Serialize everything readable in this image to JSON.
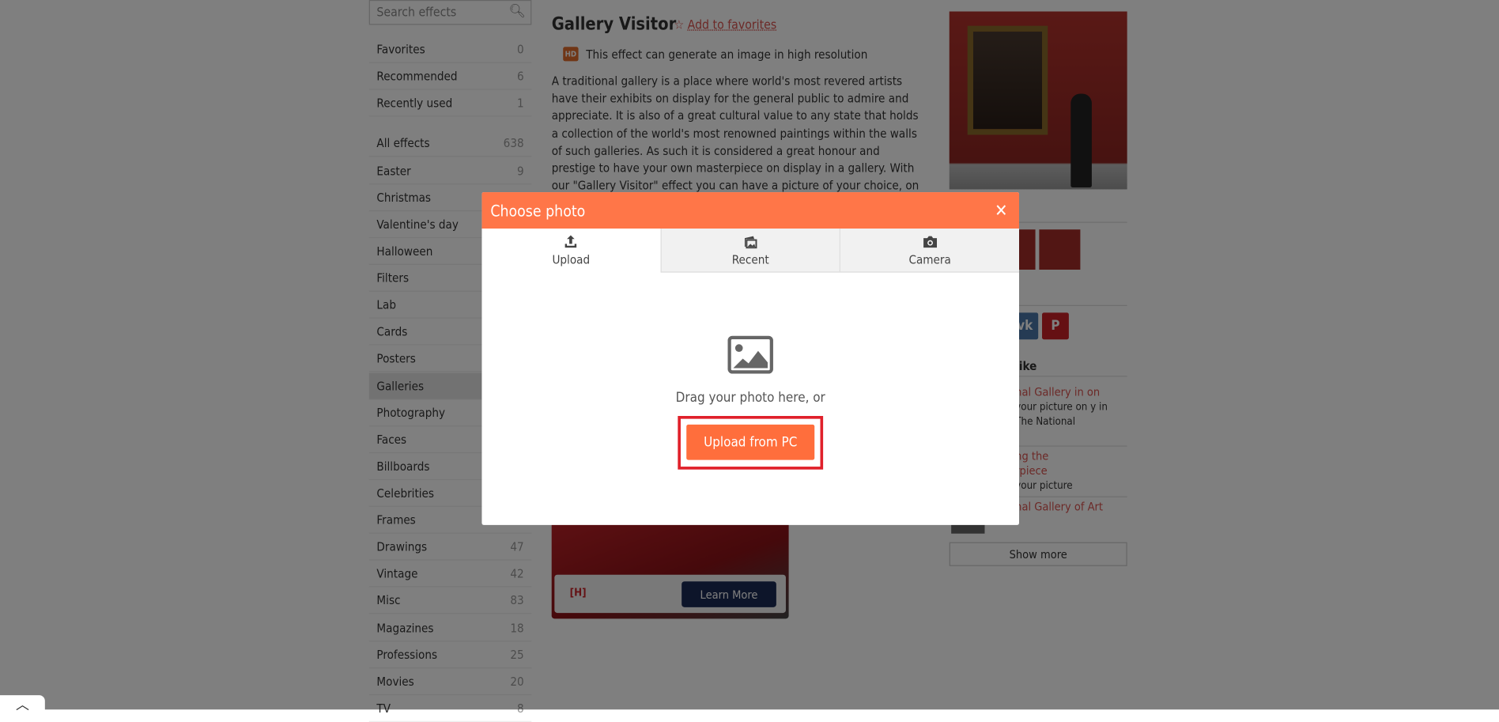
{
  "sidebar": {
    "search_placeholder": "Search effects",
    "items": [
      {
        "label": "Favorites",
        "count": "0"
      },
      {
        "label": "Recommended",
        "count": "6"
      },
      {
        "label": "Recently used",
        "count": "1"
      },
      {
        "label": "All effects",
        "count": "638"
      },
      {
        "label": "Easter",
        "count": "9"
      },
      {
        "label": "Christmas",
        "count": ""
      },
      {
        "label": "Valentine's day",
        "count": ""
      },
      {
        "label": "Halloween",
        "count": ""
      },
      {
        "label": "Filters",
        "count": ""
      },
      {
        "label": "Lab",
        "count": ""
      },
      {
        "label": "Cards",
        "count": ""
      },
      {
        "label": "Posters",
        "count": ""
      },
      {
        "label": "Galleries",
        "count": "",
        "active": true
      },
      {
        "label": "Photography",
        "count": ""
      },
      {
        "label": "Faces",
        "count": ""
      },
      {
        "label": "Billboards",
        "count": ""
      },
      {
        "label": "Celebrities",
        "count": ""
      },
      {
        "label": "Frames",
        "count": ""
      },
      {
        "label": "Drawings",
        "count": "47"
      },
      {
        "label": "Vintage",
        "count": "42"
      },
      {
        "label": "Misc",
        "count": "83"
      },
      {
        "label": "Magazines",
        "count": "18"
      },
      {
        "label": "Professions",
        "count": "25"
      },
      {
        "label": "Movies",
        "count": "20"
      },
      {
        "label": "TV",
        "count": "8"
      }
    ]
  },
  "main": {
    "title": "Gallery Visitor",
    "add_favorites": "Add to favorites",
    "hd_badge": "HD",
    "hd_text": "This effect can generate an image in high resolution",
    "description": "A traditional gallery is a place where world's most revered artists have their exhibits on display for the general public to admire and appreciate. It is also of a great cultural value to any state that holds a collection of the world's most renowned paintings within the walls of such galleries. As such it is considered a great honour and prestige to have your own masterpiece on display in a gallery. With our \"Gallery Visitor\" effect you can have a picture of your choice, on display for the public to admire, in one such gallery among other world-famous"
  },
  "right": {
    "like_heading": "like",
    "related": [
      {
        "title": "nal Gallery in on",
        "desc": "your picture on y in The National"
      },
      {
        "title": "ng the rpiece",
        "desc": "your picture"
      },
      {
        "title": "nal Gallery of Art",
        "desc": ""
      }
    ],
    "show_more": "Show more"
  },
  "ad": {
    "cta": "Learn More",
    "brand": "H"
  },
  "modal": {
    "title": "Choose photo",
    "tabs": [
      {
        "label": "Upload",
        "icon": "upload-icon"
      },
      {
        "label": "Recent",
        "icon": "recent-photos-icon"
      },
      {
        "label": "Camera",
        "icon": "camera-icon"
      }
    ],
    "active_tab": "Upload",
    "drag_text": "Drag your photo here, or",
    "upload_button": "Upload from PC"
  },
  "colors": {
    "accent": "#ff7648",
    "button": "#ff6e3c",
    "highlight": "#e0202a",
    "link": "#d9534f"
  }
}
